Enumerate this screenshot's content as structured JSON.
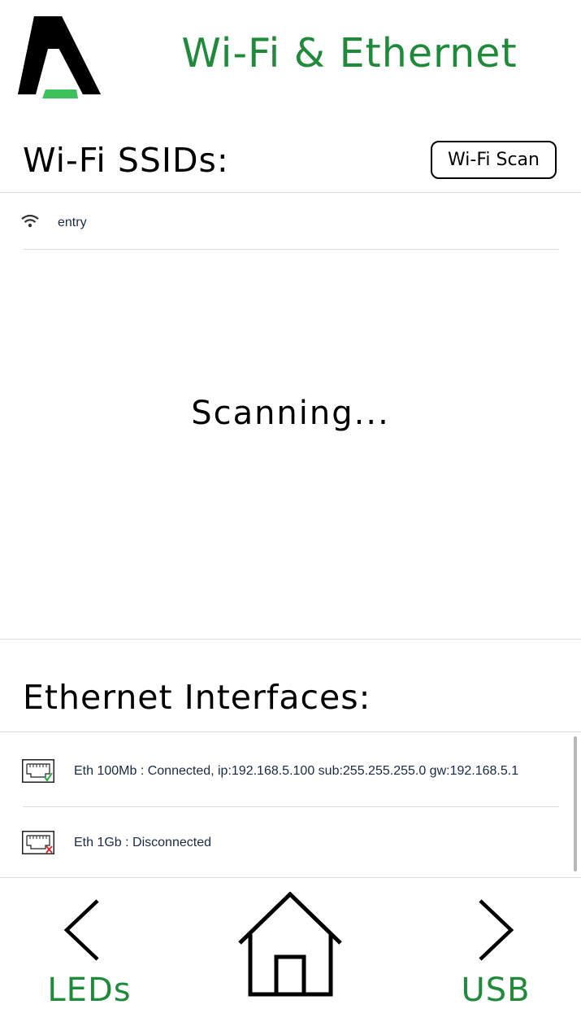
{
  "header": {
    "title": "Wi-Fi & Ethernet",
    "colors": {
      "title": "#1f8a3a",
      "logo_bar": "#3cc25a"
    }
  },
  "wifi": {
    "section_title": "Wi-Fi SSIDs:",
    "scan_button_label": "Wi-Fi Scan",
    "networks": [
      {
        "ssid": "entry",
        "icon": "wifi-icon"
      }
    ],
    "status_text": "Scanning..."
  },
  "ethernet": {
    "section_title": "Ethernet Interfaces:",
    "interfaces": [
      {
        "text": "Eth 100Mb : Connected, ip:192.168.5.100 sub:255.255.255.0 gw:192.168.5.1",
        "icon": "ethernet-connected-icon",
        "status": "connected"
      },
      {
        "text": "Eth 1Gb : Disconnected",
        "icon": "ethernet-disconnected-icon",
        "status": "disconnected"
      }
    ]
  },
  "nav": {
    "prev_label": "LEDs",
    "next_label": "USB",
    "icons": [
      "chevron-left-icon",
      "home-icon",
      "chevron-right-icon"
    ]
  }
}
